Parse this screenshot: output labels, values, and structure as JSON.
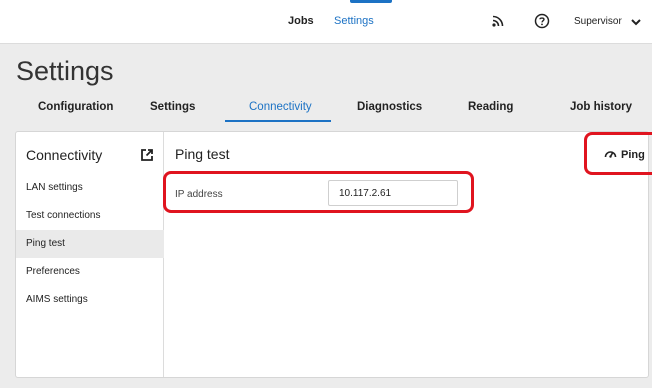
{
  "topbar": {
    "nav": [
      {
        "label": "Jobs"
      },
      {
        "label": "Settings"
      }
    ],
    "user_label": "Supervisor"
  },
  "page": {
    "title": "Settings"
  },
  "tabs": [
    {
      "label": "Configuration"
    },
    {
      "label": "Settings"
    },
    {
      "label": "Connectivity"
    },
    {
      "label": "Diagnostics"
    },
    {
      "label": "Reading"
    },
    {
      "label": "Job history"
    }
  ],
  "active_tab": "Connectivity",
  "sidebar": {
    "title": "Connectivity",
    "items": [
      {
        "label": "LAN settings"
      },
      {
        "label": "Test connections"
      },
      {
        "label": "Ping test"
      },
      {
        "label": "Preferences"
      },
      {
        "label": "AIMS settings"
      }
    ],
    "active_item": "Ping test"
  },
  "content": {
    "title": "Ping test",
    "ping_button_label": "Ping",
    "ip_field": {
      "label": "IP address",
      "value": "10.117.2.61"
    }
  },
  "colors": {
    "accent": "#1c72c4",
    "highlight": "#e0141f",
    "background": "#ececec"
  },
  "icons": [
    "rss-icon",
    "help-icon",
    "chevron-down-icon",
    "external-link-icon",
    "gauge-icon"
  ]
}
